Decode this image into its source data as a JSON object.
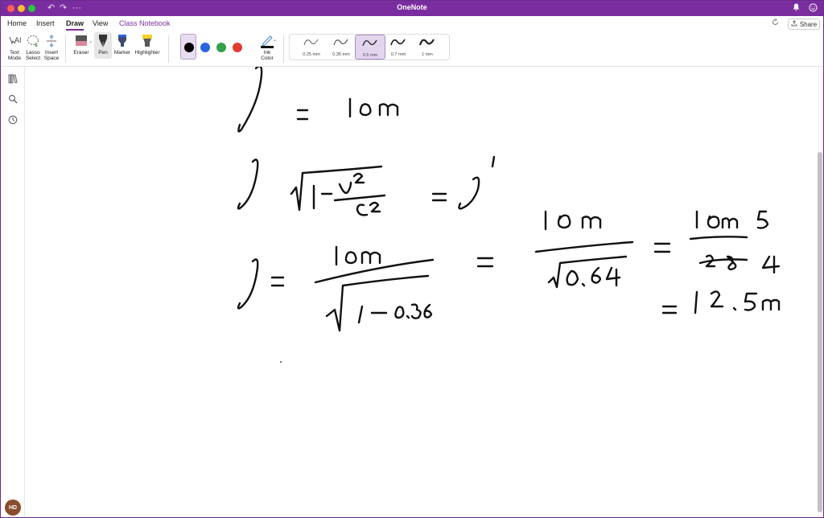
{
  "window": {
    "title": "OneNote",
    "accent": "#7a2d9e"
  },
  "titlebar": {
    "undo_icon": "undo-icon",
    "redo_icon": "redo-icon",
    "more_icon": "more-icon"
  },
  "menu": {
    "tabs": [
      {
        "label": "Home"
      },
      {
        "label": "Insert"
      },
      {
        "label": "Draw",
        "active": true
      },
      {
        "label": "View"
      },
      {
        "label": "Class Notebook"
      }
    ],
    "share_label": "Share"
  },
  "ribbon": {
    "text_mode": "Text\nMode",
    "lasso_select": "Lasso\nSelect",
    "insert_space": "Insert\nSpace",
    "eraser": "Eraser",
    "pen": "Pen",
    "marker": "Marker",
    "highlighter": "Highlighter",
    "ink_color": "Ink\nColor",
    "colors": [
      "#000000",
      "#2b64e0",
      "#34a04a",
      "#e03b2e"
    ],
    "selected_color": "#000000",
    "thicknesses": [
      {
        "label": "0.25 mm"
      },
      {
        "label": "0.35 mm"
      },
      {
        "label": "0.5 mm",
        "selected": true
      },
      {
        "label": "0.7 mm"
      },
      {
        "label": "1 mm"
      }
    ]
  },
  "user": {
    "initials": "HD"
  }
}
